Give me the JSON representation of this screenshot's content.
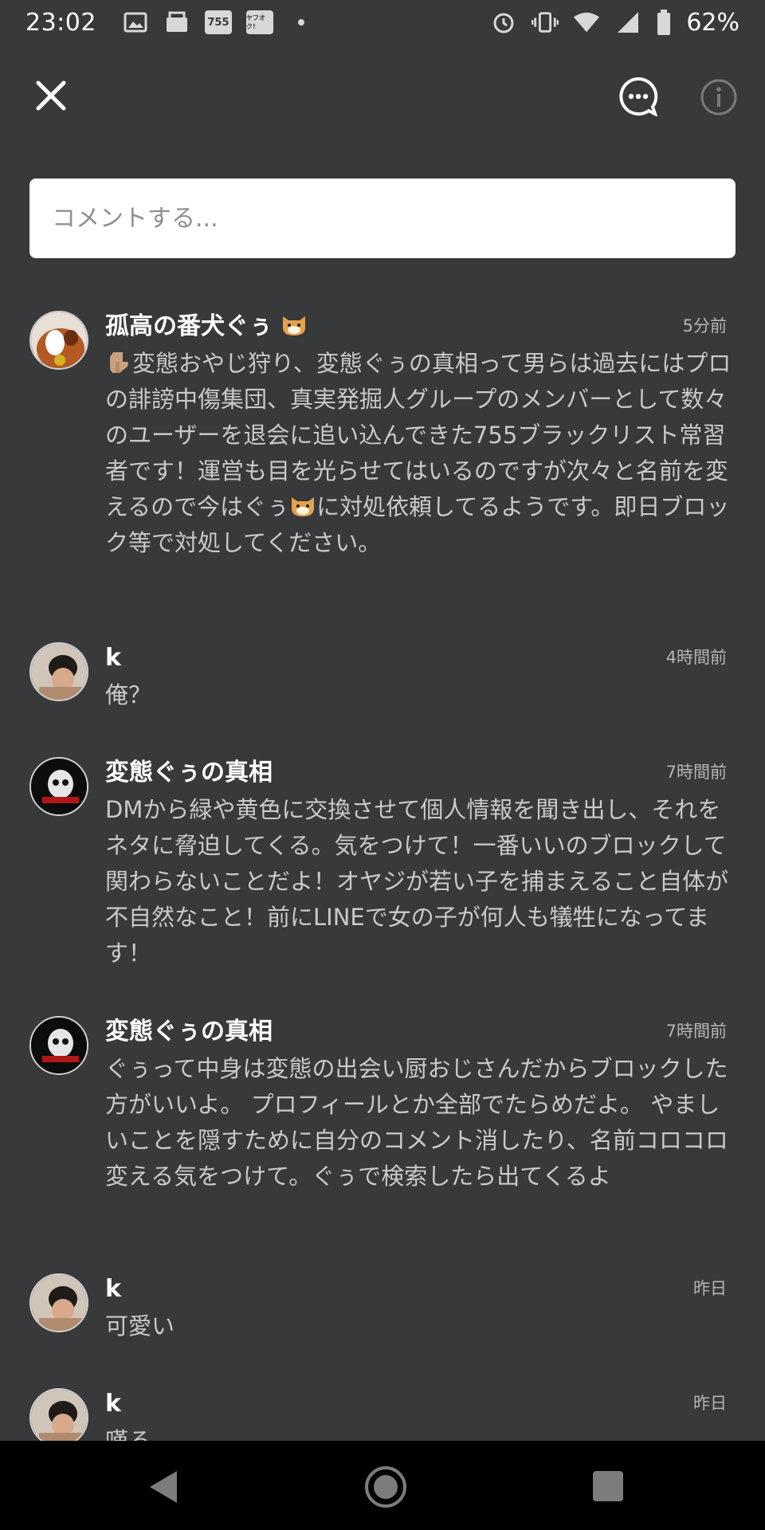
{
  "status_bar": {
    "time": "23:02",
    "box_icon_1": "755",
    "box_icon_2": "ヤフオク!",
    "battery": "62%",
    "icons": [
      "image-icon",
      "mail-icon",
      "755-app-icon",
      "yahuoku-app-icon",
      "dot-icon",
      "alarm-icon",
      "vibrate-icon",
      "wifi-icon",
      "signal-icon",
      "battery-icon"
    ]
  },
  "header": {
    "icons": [
      "close-icon",
      "comment-dots-icon",
      "info-icon"
    ]
  },
  "comment_input": {
    "placeholder": "コメントする..."
  },
  "comments": [
    {
      "name": "孤高の番犬ぐぅ",
      "time": "5分前",
      "body_part1": "変態おやじ狩り、変態ぐぅの真相って男らは過去にはプロの誹謗中傷集団、真実発掘人グループのメンバーとして数々のユーザーを退会に追い込んできた755ブラックリスト常習者です！運営も目を光らせてはいるのですが次々と名前を変えるので今はぐぅ",
      "body_part2": "に対処依頼してるようです。即日ブロック等で対処してください。"
    },
    {
      "name": "k",
      "time": "4時間前",
      "body": "俺？"
    },
    {
      "name": "変態ぐぅの真相",
      "time": "7時間前",
      "body": "DMから緑や黄色に交換させて個人情報を聞き出し、それをネタに脅迫してくる。気をつけて！一番いいのブロックして関わらないことだよ！オヤジが若い子を捕まえること自体が不自然なこと！前にLINEで女の子が何人も犠牲になってます！"
    },
    {
      "name": "変態ぐぅの真相",
      "time": "7時間前",
      "body": "ぐぅって中身は変態の出会い厨おじさんだからブロックした方がいいよ。 プロフィールとか全部でたらめだよ。 やましいことを隠すために自分のコメント消したり、名前コロコロ変える気をつけて。ぐぅで検索したら出てくるよ"
    },
    {
      "name": "k",
      "time": "昨日",
      "body": "可愛い"
    },
    {
      "name": "k",
      "time": "昨日",
      "body": "嘆る..."
    }
  ],
  "colors": {
    "background": "#38393b",
    "name": "#ffffff",
    "body": "#c9c9c9",
    "time": "#b5b5b5",
    "nav_bar": "#000000"
  }
}
